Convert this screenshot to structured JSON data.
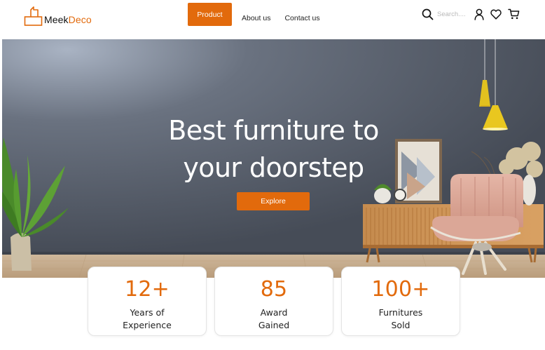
{
  "brand": {
    "name_part1": "Meek",
    "name_part2": "Deco",
    "accent_color": "#e26a0c"
  },
  "nav": {
    "items": [
      {
        "label": "Product",
        "active": true
      },
      {
        "label": "About us",
        "active": false
      },
      {
        "label": "Contact us",
        "active": false
      }
    ]
  },
  "tools": {
    "search_placeholder": "Search....",
    "icons": [
      "search-icon",
      "user-icon",
      "heart-icon",
      "cart-icon"
    ]
  },
  "hero": {
    "title_line1": "Best furniture to",
    "title_line2": "your doorstep",
    "cta_label": "Explore"
  },
  "stats": [
    {
      "value": "12+",
      "label_line1": "Years of",
      "label_line2": "Experience"
    },
    {
      "value": "85",
      "label_line1": "Award",
      "label_line2": "Gained"
    },
    {
      "value": "100+",
      "label_line1": "Furnitures",
      "label_line2": "Sold"
    }
  ]
}
